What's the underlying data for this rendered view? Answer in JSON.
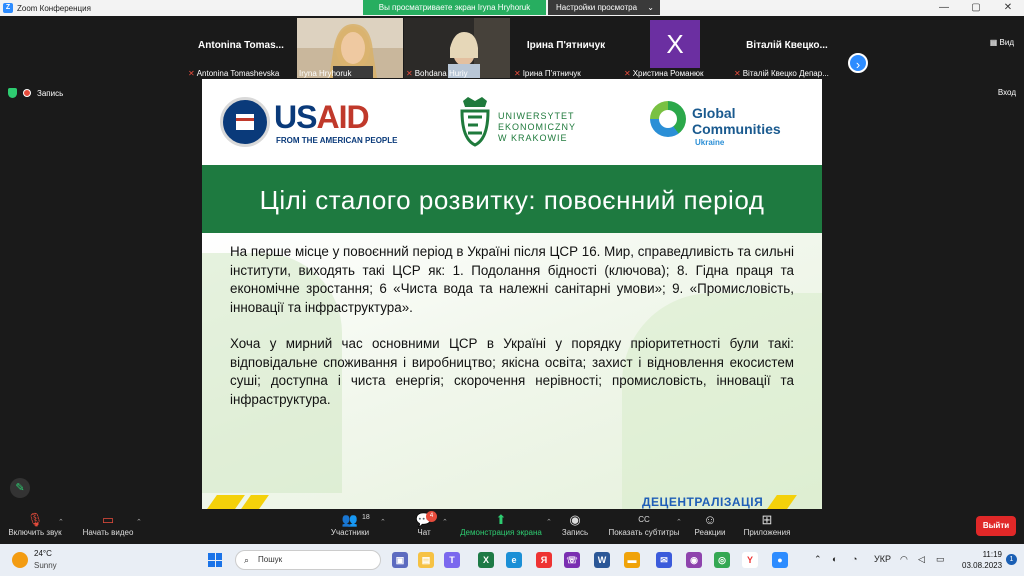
{
  "window": {
    "title": "Zoom Конференция",
    "share_banner": "Вы просматриваете экран Iryna Hryhoruk",
    "view_settings": "Настройки просмотра",
    "minimize": "—",
    "restore": "▢",
    "close": "✕"
  },
  "participants_strip": {
    "tiles": [
      {
        "display_name": "Antonina  Tomas...",
        "label": "Antonina Tomashevska",
        "muted": true
      },
      {
        "display_name": "",
        "label": "Iryna Hryhoruk",
        "muted": false
      },
      {
        "display_name": "",
        "label": "Bohdana Huriy",
        "muted": true
      },
      {
        "display_name": "Ірина  П'ятничук",
        "label": "Ірина П'ятничук",
        "muted": true
      },
      {
        "display_name": "X",
        "label": "Христина Романюк",
        "muted": true
      },
      {
        "display_name": "Віталій  Квецко...",
        "label": "Віталій Квецко Депар...",
        "muted": true
      }
    ],
    "next_arrow": "›",
    "view_label": "Вид"
  },
  "status": {
    "recording_label": "Запись",
    "exit_label": "Вход"
  },
  "slide": {
    "usaid_word_a": "US",
    "usaid_word_b": "AID",
    "usaid_sub": "FROM THE AMERICAN PEOPLE",
    "uek_line1": "UNIWERSYTET",
    "uek_line2": "EKONOMICZNY",
    "uek_line3": "W KRAKOWIE",
    "gc_line1": "Global",
    "gc_line2": "Communities",
    "gc_sub": "Ukraine",
    "title": "Цілі сталого розвитку: повоєнний період",
    "paragraph1": "На перше місце у повоєнний період в Україні після ЦСР 16. Мир, справедливість та сильні інститути, виходять такі ЦСР як: 1. Подолання бідності (ключова); 8. Гідна праця та економічне зростання; 6 «Чиста вода та належні санітарні умови»; 9. «Промисловість, інновації та інфраструктура».",
    "paragraph2": "Хоча у мирний час основними ЦСР в Україні у порядку пріоритетності були такі: відповідальне споживання і виробництво; якісна освіта; захист і відновлення екосистем суші; доступна і чиста енергія; скорочення нерівності; промисловість, інновації та інфраструктура.",
    "footer_brand": "ДЕЦЕНТРАЛІЗАЦІЯ"
  },
  "toolbar": {
    "unmute": "Включить звук",
    "start_video": "Начать видео",
    "participants": "Участники",
    "participants_count": "18",
    "chat": "Чат",
    "chat_badge": "4",
    "share_screen": "Демонстрация экрана",
    "record": "Запись",
    "captions": "Показать субтитры",
    "reactions": "Реакции",
    "apps": "Приложения",
    "leave": "Выйти"
  },
  "taskbar": {
    "temperature": "24°C",
    "condition": "Sunny",
    "search_placeholder": "Пошук",
    "language": "УКР",
    "time": "11:19",
    "date": "03.08.2023",
    "notifications": "1"
  },
  "colors": {
    "slide_title_band": "#1e7a40",
    "zoom_blue": "#2d8cff",
    "share_green": "#27ae60",
    "leave_red": "#e02828"
  }
}
